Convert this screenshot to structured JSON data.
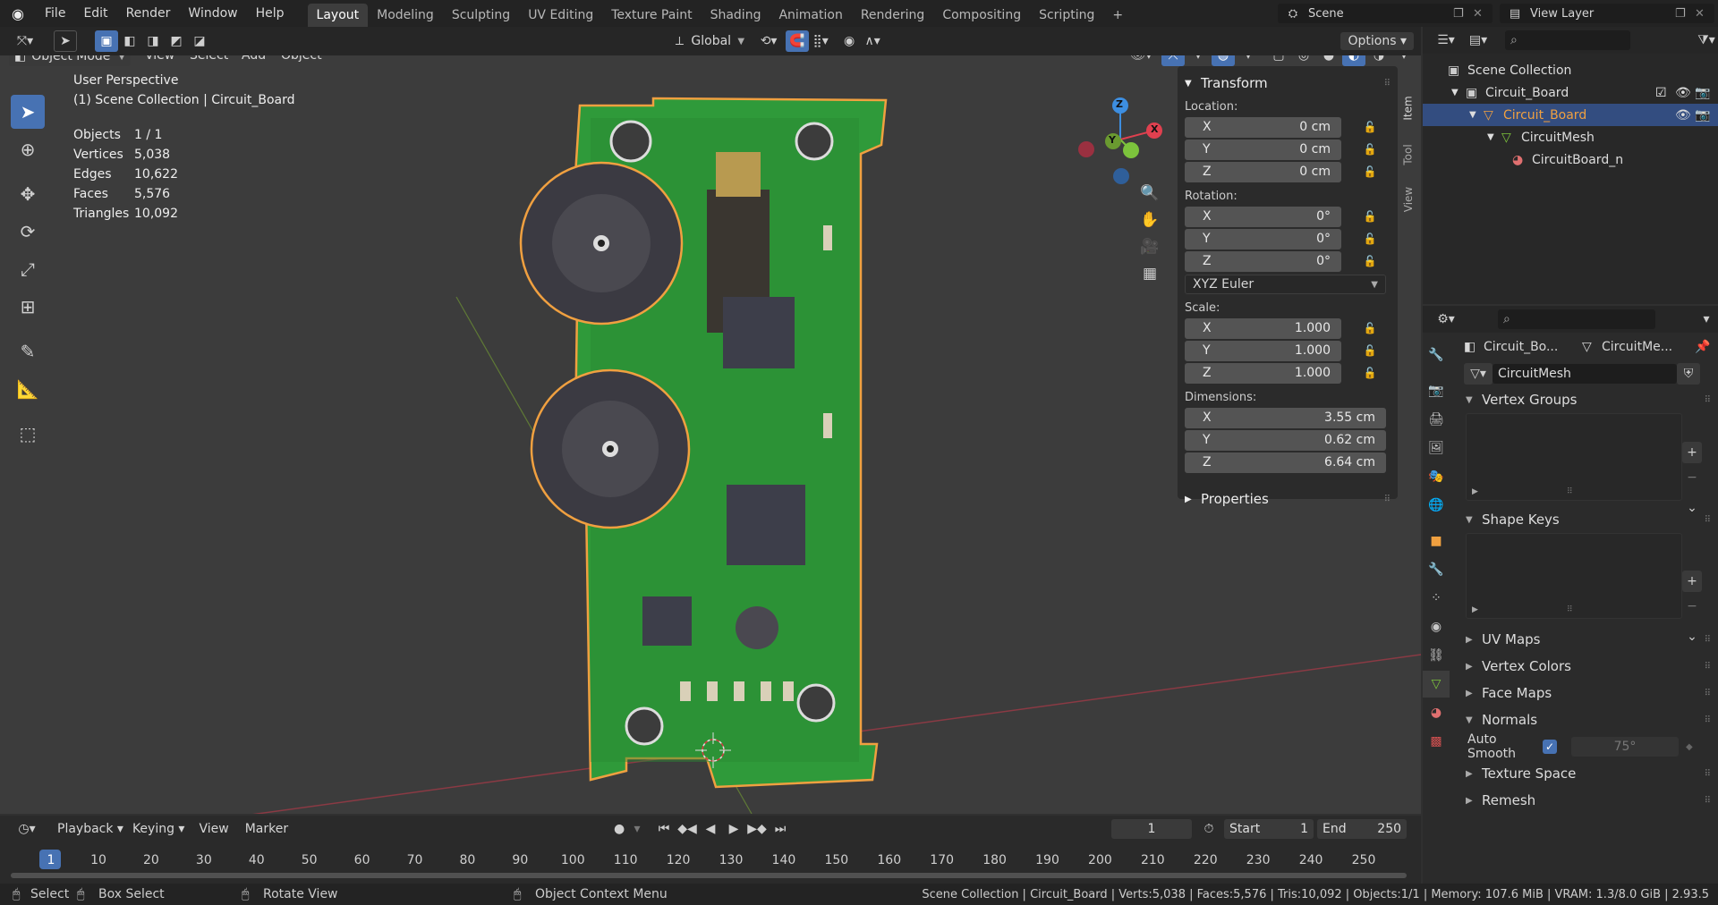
{
  "menubar": {
    "items": [
      "File",
      "Edit",
      "Render",
      "Window",
      "Help"
    ]
  },
  "workspace_tabs": [
    "Layout",
    "Modeling",
    "Sculpting",
    "UV Editing",
    "Texture Paint",
    "Shading",
    "Animation",
    "Rendering",
    "Compositing",
    "Scripting"
  ],
  "scene": {
    "name": "Scene",
    "view_layer": "View Layer"
  },
  "viewport_header": {
    "mode": "Object Mode",
    "menus": [
      "View",
      "Select",
      "Add",
      "Object"
    ],
    "orientation": "Global",
    "options": "Options"
  },
  "overlay": {
    "perspective": "User Perspective",
    "collection": "(1) Scene Collection | Circuit_Board",
    "stats": [
      {
        "k": "Objects",
        "v": "1 / 1"
      },
      {
        "k": "Vertices",
        "v": "5,038"
      },
      {
        "k": "Edges",
        "v": "10,622"
      },
      {
        "k": "Faces",
        "v": "5,576"
      },
      {
        "k": "Triangles",
        "v": "10,092"
      }
    ]
  },
  "gizmo": {
    "x": "X",
    "y": "Y",
    "z": "Z"
  },
  "npanel": {
    "transform_title": "Transform",
    "location_label": "Location:",
    "rotation_label": "Rotation:",
    "scale_label": "Scale:",
    "dimensions_label": "Dimensions:",
    "location": [
      {
        "axis": "X",
        "value": "0 cm"
      },
      {
        "axis": "Y",
        "value": "0 cm"
      },
      {
        "axis": "Z",
        "value": "0 cm"
      }
    ],
    "rotation": [
      {
        "axis": "X",
        "value": "0°"
      },
      {
        "axis": "Y",
        "value": "0°"
      },
      {
        "axis": "Z",
        "value": "0°"
      }
    ],
    "rotation_mode": "XYZ Euler",
    "scale": [
      {
        "axis": "X",
        "value": "1.000"
      },
      {
        "axis": "Y",
        "value": "1.000"
      },
      {
        "axis": "Z",
        "value": "1.000"
      }
    ],
    "dimensions": [
      {
        "axis": "X",
        "value": "3.55 cm"
      },
      {
        "axis": "Y",
        "value": "0.62 cm"
      },
      {
        "axis": "Z",
        "value": "6.64 cm"
      }
    ],
    "properties_title": "Properties",
    "side_tabs": [
      "Item",
      "Tool",
      "View"
    ]
  },
  "outliner": {
    "rows": [
      "Scene Collection",
      "Circuit_Board",
      "Circuit_Board",
      "CircuitMesh",
      "CircuitBoard_n"
    ]
  },
  "properties": {
    "breadcrumb_obj": "Circuit_Bo...",
    "breadcrumb_mesh": "CircuitMe...",
    "mesh_name": "CircuitMesh",
    "sections": {
      "vertex_groups": "Vertex Groups",
      "shape_keys": "Shape Keys",
      "uv_maps": "UV Maps",
      "vertex_colors": "Vertex Colors",
      "face_maps": "Face Maps",
      "normals": "Normals",
      "texture_space": "Texture Space",
      "remesh": "Remesh"
    },
    "auto_smooth_label": "Auto Smooth",
    "auto_smooth_angle": "75°",
    "auto_smooth_checked": true
  },
  "timeline": {
    "menus": [
      "Playback",
      "Keying",
      "View",
      "Marker"
    ],
    "current_frame": "1",
    "start_label": "Start",
    "start": "1",
    "end_label": "End",
    "end": "250",
    "ticks": [
      "1",
      "10",
      "20",
      "30",
      "40",
      "50",
      "60",
      "70",
      "80",
      "90",
      "100",
      "110",
      "120",
      "130",
      "140",
      "150",
      "160",
      "170",
      "180",
      "190",
      "200",
      "210",
      "220",
      "230",
      "240",
      "250"
    ]
  },
  "statusbar": {
    "select": "Select",
    "box_select": "Box Select",
    "rotate_view": "Rotate View",
    "context_menu": "Object Context Menu",
    "info": "Scene Collection | Circuit_Board | Verts:5,038 | Faces:5,576 | Tris:10,092 | Objects:1/1 | Memory: 107.6 MiB | VRAM: 1.3/8.0 GiB | 2.93.5"
  },
  "colors": {
    "accent": "#4772b3",
    "selection_outline": "#f0a040",
    "x_axis": "#e0404f",
    "y_axis": "#7cc33c",
    "z_axis": "#3d8ee0",
    "pcb_green": "#2f9a3a"
  }
}
